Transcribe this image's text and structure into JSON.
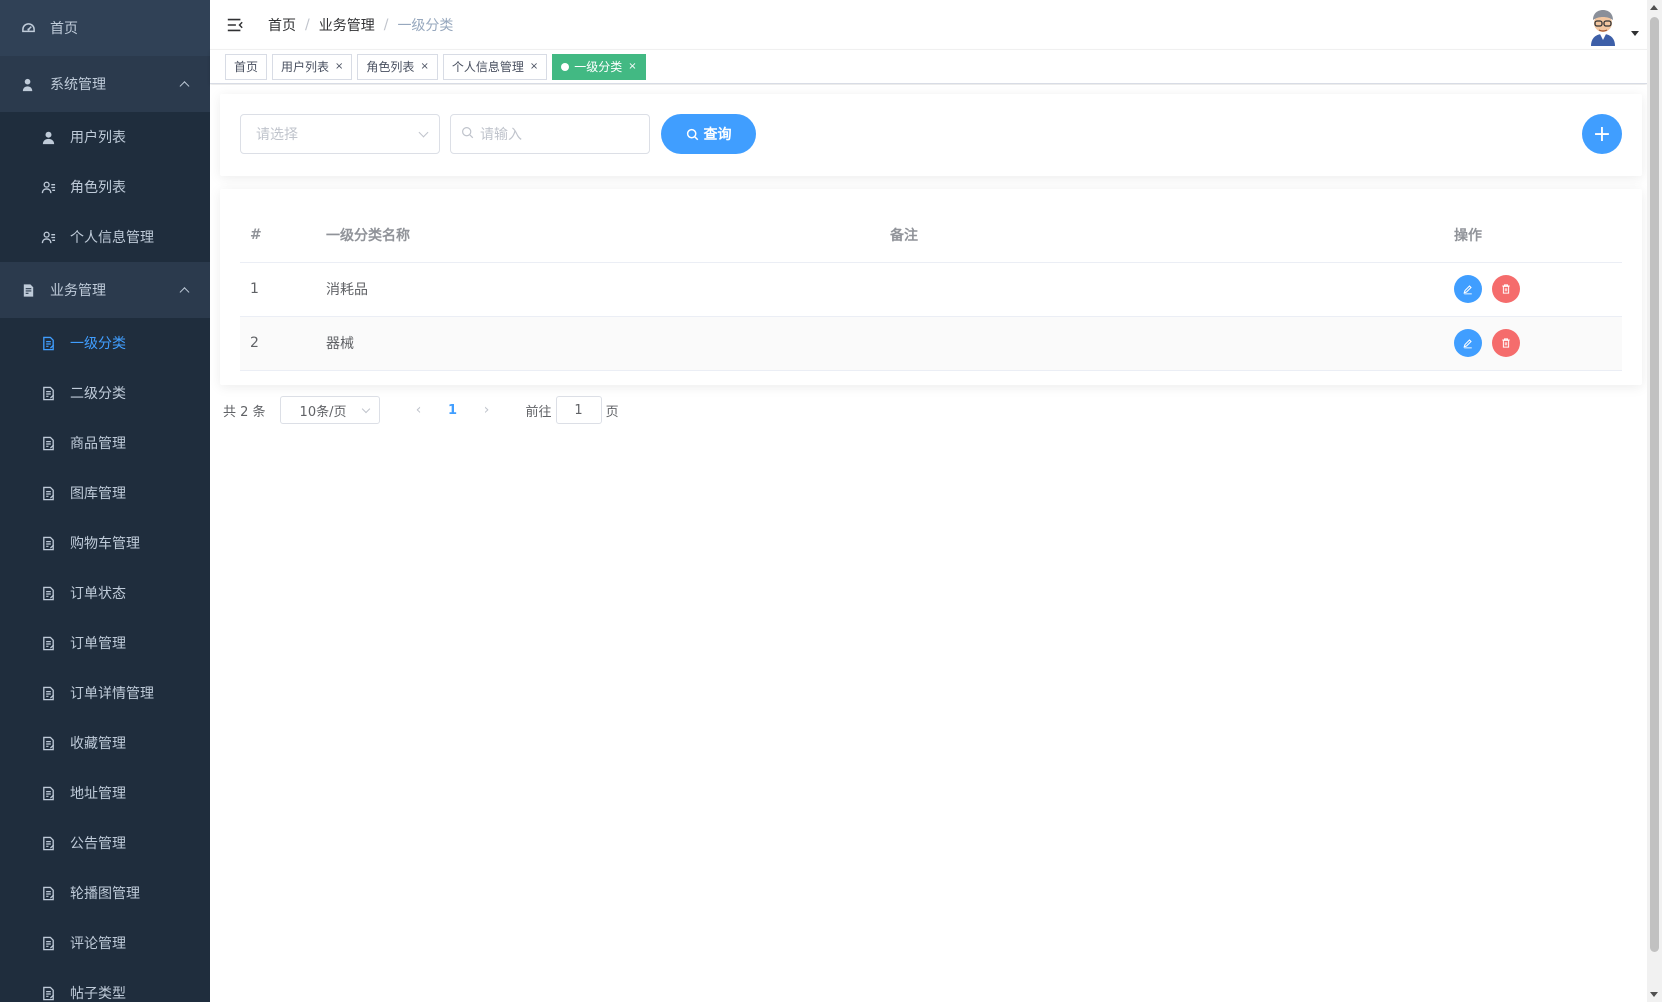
{
  "sidebar": {
    "home": "首页",
    "groups": [
      {
        "title": "系统管理",
        "items": [
          "用户列表",
          "角色列表",
          "个人信息管理"
        ]
      },
      {
        "title": "业务管理",
        "items": [
          "一级分类",
          "二级分类",
          "商品管理",
          "图库管理",
          "购物车管理",
          "订单状态",
          "订单管理",
          "订单详情管理",
          "收藏管理",
          "地址管理",
          "公告管理",
          "轮播图管理",
          "评论管理",
          "帖子类型"
        ]
      }
    ],
    "active_item": "一级分类",
    "colors": {
      "bg": "#1f2d3d",
      "active": "#409eff",
      "text": "#bfcbd9"
    }
  },
  "header": {
    "breadcrumb": [
      "首页",
      "业务管理",
      "一级分类"
    ],
    "breadcrumb_separator": "/"
  },
  "tags": [
    {
      "label": "首页",
      "closable": false,
      "active": false
    },
    {
      "label": "用户列表",
      "closable": true,
      "active": false
    },
    {
      "label": "角色列表",
      "closable": true,
      "active": false
    },
    {
      "label": "个人信息管理",
      "closable": true,
      "active": false
    },
    {
      "label": "一级分类",
      "closable": true,
      "active": true
    }
  ],
  "tag_close_glyph": "×",
  "search": {
    "select_placeholder": "请选择",
    "input_placeholder": "请输入",
    "query_label": "查询",
    "add_label": "+"
  },
  "table": {
    "columns": [
      "#",
      "一级分类名称",
      "备注",
      "操作"
    ],
    "rows": [
      {
        "index": "1",
        "name": "消耗品",
        "remark": ""
      },
      {
        "index": "2",
        "name": "器械",
        "remark": ""
      }
    ]
  },
  "pagination": {
    "total": "共 2 条",
    "page_size": "10条/页",
    "prev": "‹",
    "next": "›",
    "current_page": "1",
    "goto_label": "前往",
    "goto_value": "1",
    "goto_suffix": "页"
  },
  "colors": {
    "primary": "#409eff",
    "danger": "#f56c6c",
    "tag_active": "#42b983"
  }
}
